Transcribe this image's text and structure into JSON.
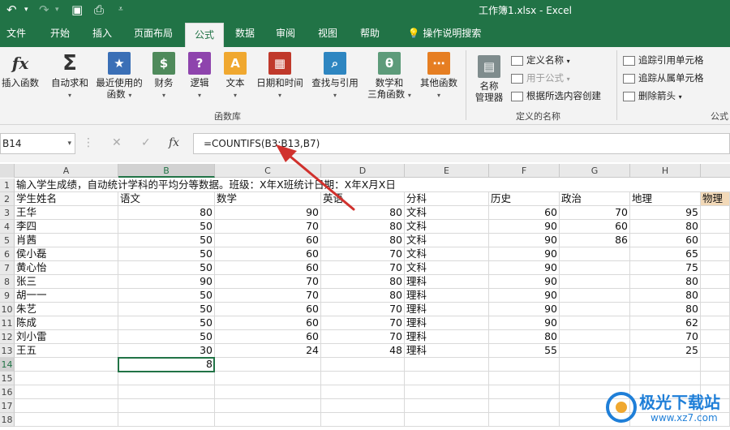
{
  "titlebar": {
    "title": "工作簿1.xlsx  -  Excel"
  },
  "tabs": [
    "文件",
    "开始",
    "插入",
    "页面布局",
    "公式",
    "数据",
    "审阅",
    "视图",
    "帮助",
    "操作说明搜索"
  ],
  "active_tab": "公式",
  "ribbon": {
    "buttons": [
      {
        "label": "插入函数",
        "icon": "fx-icon"
      },
      {
        "label": "自动求和",
        "icon": "sigma-icon"
      },
      {
        "label": "最近使用的",
        "label2": "函数",
        "icon": "star-icon"
      },
      {
        "label": "财务",
        "icon": "finance-icon"
      },
      {
        "label": "逻辑",
        "icon": "logic-icon"
      },
      {
        "label": "文本",
        "icon": "text-icon"
      },
      {
        "label": "日期和时间",
        "icon": "calendar-icon"
      },
      {
        "label": "查找与引用",
        "icon": "lookup-icon"
      },
      {
        "label": "数学和",
        "label2": "三角函数",
        "icon": "math-icon"
      },
      {
        "label": "其他函数",
        "icon": "more-functions-icon"
      }
    ],
    "group_function_library": "函数库",
    "name_manager": {
      "line1": "名称",
      "line2": "管理器"
    },
    "define_name": "定义名称",
    "use_in_formula": "用于公式",
    "create_from_selection": "根据所选内容创建",
    "group_defined_names": "定义的名称",
    "trace_precedents": "追踪引用单元格",
    "trace_dependents": "追踪从属单元格",
    "remove_arrows": "删除箭头",
    "group_formula_auditing": "公式"
  },
  "formula_bar": {
    "name_box": "B14",
    "fx": "fx",
    "formula": "=COUNTIFS(B3:B13,B7)"
  },
  "columns": [
    "A",
    "B",
    "C",
    "D",
    "E",
    "F",
    "G",
    "H"
  ],
  "rows": [
    "1",
    "2",
    "3",
    "4",
    "5",
    "6",
    "7",
    "8",
    "9",
    "10",
    "11",
    "12",
    "13",
    "14",
    "15",
    "16",
    "17",
    "18"
  ],
  "sheet": {
    "r1": "输入学生成绩，自动统计学科的平均分等数据。班级：X年X班统计日期：X年X月X日",
    "headers": [
      "学生姓名",
      "语文",
      "数学",
      "英语",
      "分科",
      "历史",
      "政治",
      "地理",
      "物理"
    ],
    "data": [
      [
        "王华",
        "80",
        "90",
        "80",
        "文科",
        "60",
        "70",
        "95"
      ],
      [
        "李四",
        "50",
        "70",
        "80",
        "文科",
        "90",
        "60",
        "80"
      ],
      [
        "肖茜",
        "50",
        "60",
        "80",
        "文科",
        "90",
        "86",
        "60"
      ],
      [
        "侯小磊",
        "50",
        "60",
        "70",
        "文科",
        "90",
        "",
        "65"
      ],
      [
        "黄心怡",
        "50",
        "60",
        "70",
        "文科",
        "90",
        "",
        "75"
      ],
      [
        "张三",
        "90",
        "70",
        "80",
        "理科",
        "90",
        "",
        "80"
      ],
      [
        "胡一一",
        "50",
        "70",
        "80",
        "理科",
        "90",
        "",
        "80"
      ],
      [
        "朱艺",
        "50",
        "60",
        "70",
        "理科",
        "90",
        "",
        "80"
      ],
      [
        "陈成",
        "50",
        "60",
        "70",
        "理科",
        "90",
        "",
        "62"
      ],
      [
        "刘小雷",
        "50",
        "60",
        "70",
        "理科",
        "80",
        "",
        "70"
      ],
      [
        "王五",
        "30",
        "24",
        "48",
        "理科",
        "55",
        "",
        "25"
      ]
    ],
    "b14": "8"
  },
  "watermark": {
    "main": "极光下载站",
    "url": "www.xz7.com"
  },
  "colors": {
    "brand": "#217346",
    "header_bg": "#e9e9e9",
    "arrow": "#d0312d",
    "watermark": "#1f7fd8"
  }
}
